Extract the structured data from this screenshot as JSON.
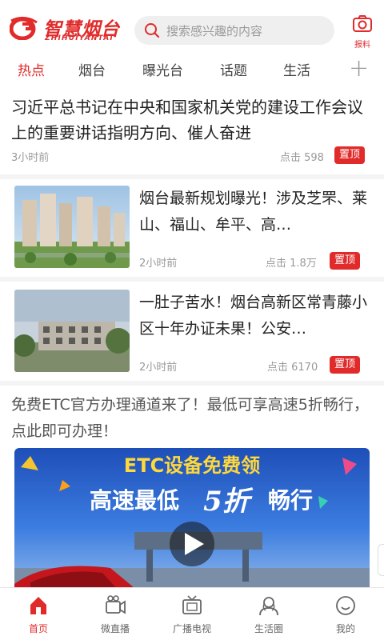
{
  "header": {
    "logo_text": "智慧烟台",
    "logo_sub": "ZHIHUIYANTAI",
    "search_placeholder": "搜索感兴趣的内容",
    "report_label": "报料",
    "brand_color": "#e12b2b"
  },
  "tabs": [
    {
      "label": "热点",
      "active": true
    },
    {
      "label": "烟台",
      "active": false
    },
    {
      "label": "曝光台",
      "active": false
    },
    {
      "label": "话题",
      "active": false
    },
    {
      "label": "生活",
      "active": false
    }
  ],
  "tab_add_icon": "plus-icon",
  "feed": {
    "top_story": {
      "title": "习近平总书记在中央和国家机关党的建设工作会议上的重要讲话指明方向、催人奋进",
      "time": "3小时前",
      "clicks": "点击 598",
      "pin_label": "置顶"
    },
    "items": [
      {
        "title": "烟台最新规划曝光！涉及芝罘、莱山、福山、牟平、高…",
        "time": "2小时前",
        "clicks": "点击 1.8万",
        "pin_label": "置顶"
      },
      {
        "title": "一肚子苦水！烟台高新区常青藤小区十年办证未果！公安…",
        "time": "2小时前",
        "clicks": "点击 6170",
        "pin_label": "置顶"
      }
    ],
    "ad": {
      "title": "免费ETC官方办理通道来了！最低可享高速5折畅行，点此即可办理！",
      "banner_line1": "ETC设备免费领",
      "banner_line2_a": "高速最低",
      "banner_line2_b": "5折",
      "banner_line2_c": "畅行"
    }
  },
  "bottom_nav": [
    {
      "label": "首页",
      "icon": "home-icon",
      "active": true
    },
    {
      "label": "微直播",
      "icon": "video-camera-icon",
      "active": false
    },
    {
      "label": "广播电视",
      "icon": "tv-icon",
      "active": false
    },
    {
      "label": "生活圈",
      "icon": "people-icon",
      "active": false
    },
    {
      "label": "我的",
      "icon": "smiley-icon",
      "active": false
    }
  ]
}
